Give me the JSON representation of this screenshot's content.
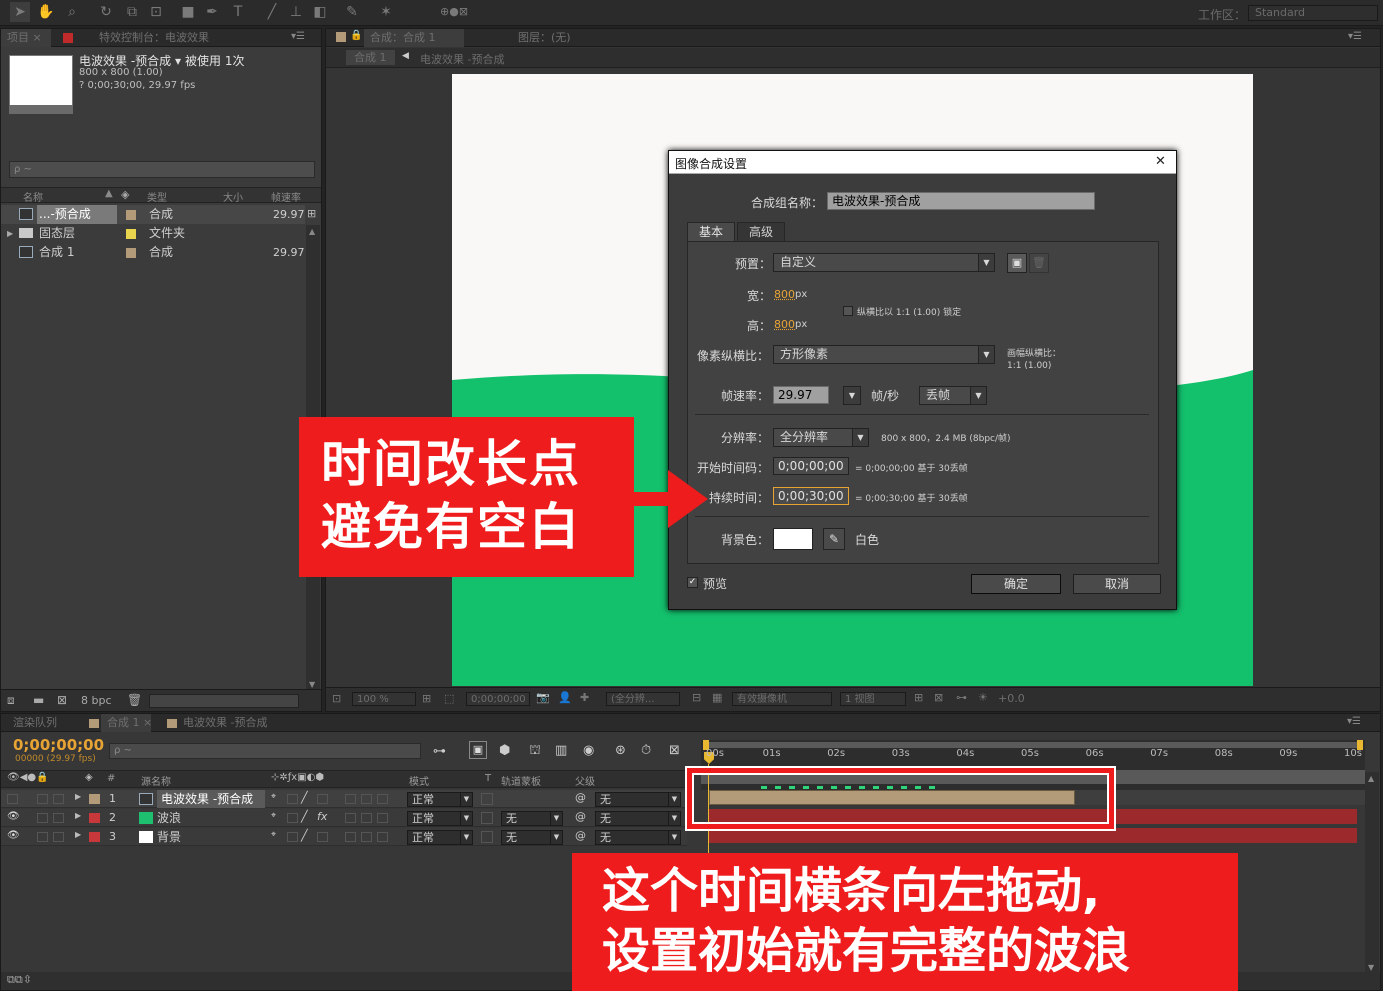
{
  "toolbar": {
    "workspace_label": "工作区：",
    "workspace_value": "Standard"
  },
  "project_panel": {
    "tab_project": "项目 ×",
    "tab_effects": "特效控制台：电波效果",
    "item_name": "电波效果 -预合成 ▾",
    "used_times": "被使用 1次",
    "dims": "800 x 800 (1.00)",
    "duration": "? 0;00;30;00, 29.97 fps",
    "search_placeholder": "ρ ~",
    "columns": {
      "name": "名称",
      "type": "类型",
      "size": "大小",
      "fps": "帧速率"
    },
    "rows": [
      {
        "name": "...-预合成",
        "type": "合成",
        "fps": "29.97"
      },
      {
        "name": "固态层",
        "type": "文件夹",
        "fps": ""
      },
      {
        "name": "合成 1",
        "type": "合成",
        "fps": "29.97"
      }
    ],
    "bpc": "8 bpc"
  },
  "comp_panel": {
    "tab_comp": "合成：合成 1",
    "tab_layer": "图层：(无)",
    "crumb_comp": "合成 1",
    "crumb_sub": "电波效果 -预合成",
    "zoom": "100 %",
    "timecode": "0;00;00;00",
    "resolution": "(全分辨...",
    "camera": "有效摄像机",
    "views": "1 视图",
    "offset": "+0.0"
  },
  "dialog": {
    "title": "图像合成设置",
    "close": "✕",
    "name_label": "合成组名称：",
    "name_value": "电波效果-预合成",
    "tab_basic": "基本",
    "tab_advanced": "高级",
    "preset_label": "预置：",
    "preset_value": "自定义",
    "width_label": "宽：",
    "width_value": "800",
    "height_label": "高：",
    "height_value": "800",
    "px": "px",
    "lock_label": "纵横比以 1:1 (1.00) 锁定",
    "par_label": "像素纵横比：",
    "par_value": "方形像素",
    "frame_aspect_label": "画幅纵横比：",
    "frame_aspect_value": "1:1 (1.00)",
    "fps_label": "帧速率：",
    "fps_value": "29.97",
    "fps_unit": "帧/秒",
    "drop_frame": "丢帧",
    "res_label": "分辨率：",
    "res_value": "全分辨率",
    "res_info": "800 x 800，2.4 MB (8bpc/帧)",
    "start_label": "开始时间码：",
    "start_value": "0;00;00;00",
    "start_info": "= 0;00;00;00  基于 30丢帧",
    "dur_label": "持续时间：",
    "dur_value": "0;00;30;00",
    "dur_info": "= 0;00;30;00  基于 30丢帧",
    "bg_label": "背景色：",
    "bg_name": "白色",
    "preview": "预览",
    "ok": "确定",
    "cancel": "取消"
  },
  "timeline": {
    "tab_render": "渲染队列",
    "tab_comp1": "合成 1 ×",
    "tab_pre": "电波效果 -预合成",
    "timecode": "0;00;00;00",
    "fps": "00000 (29.97 fps)",
    "search_placeholder": "ρ ~",
    "cols": {
      "num": "#",
      "name": "源名称",
      "mode": "模式",
      "t": "T",
      "track": "轨道蒙板",
      "parent": "父级"
    },
    "layers": [
      {
        "num": "1",
        "name": "电波效果 -预合成",
        "mode": "正常",
        "track": "",
        "parent": "无",
        "color": "#b39b79",
        "swatch": "#c2a584"
      },
      {
        "num": "2",
        "name": "波浪",
        "mode": "正常",
        "track": "无",
        "parent": "无",
        "color": "#c8373a",
        "swatch": "#1ec06f"
      },
      {
        "num": "3",
        "name": "背景",
        "mode": "正常",
        "track": "无",
        "parent": "无",
        "color": "#c8373a",
        "swatch": "#ffffff"
      }
    ],
    "ruler": [
      "00s",
      "01s",
      "02s",
      "03s",
      "04s",
      "05s",
      "06s",
      "07s",
      "08s",
      "09s",
      "10s"
    ]
  },
  "annotations": {
    "callout1_line1": "时间改长点",
    "callout1_line2": "避免有空白",
    "callout2_line1": "这个时间横条向左拖动,",
    "callout2_line2": "设置初始就有完整的波浪"
  },
  "colors": {
    "green": "#13c06c",
    "callout_red": "#ee1c1c",
    "accent_orange": "#e8a335"
  }
}
